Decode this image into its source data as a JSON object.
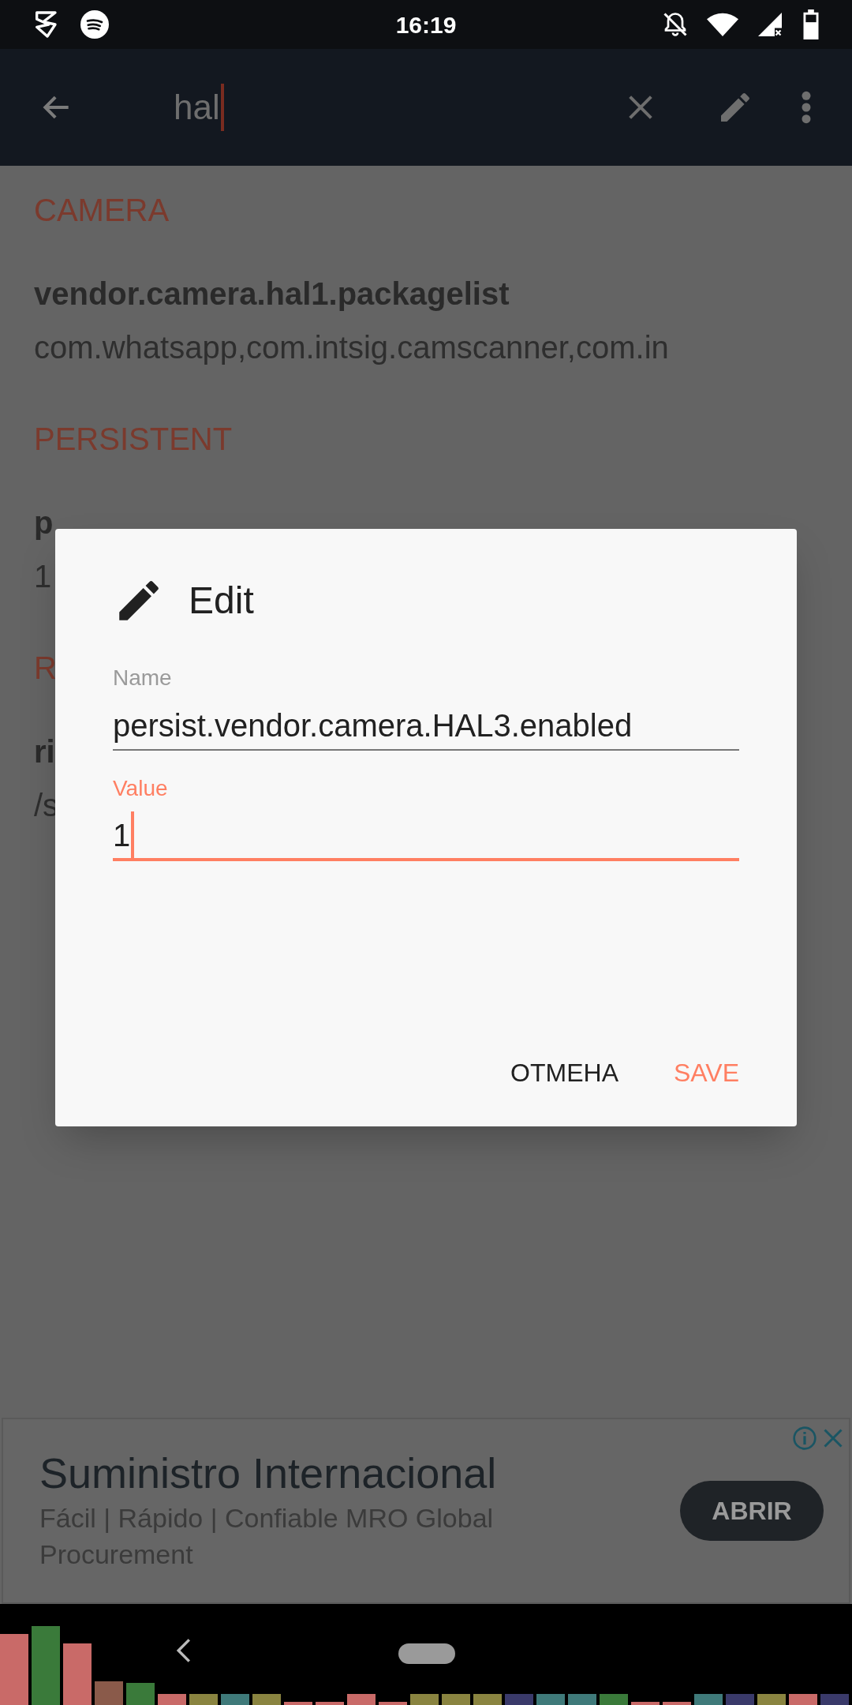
{
  "status_bar": {
    "time": "16:19"
  },
  "toolbar": {
    "search": {
      "value": "hal"
    }
  },
  "sections": [
    {
      "title": "CAMERA",
      "items": [
        {
          "name": "vendor.camera.hal1.packagelist",
          "value": "com.whatsapp,com.intsig.camscanner,com.in"
        }
      ]
    },
    {
      "title": "PERSISTENT",
      "items": [
        {
          "name": "p",
          "value": "1"
        }
      ]
    },
    {
      "title": "R",
      "items": [
        {
          "name": "ri",
          "value": "/s"
        }
      ]
    }
  ],
  "dialog": {
    "title": "Edit",
    "fields": [
      {
        "label": "Name",
        "value": "persist.vendor.camera.HAL3.enabled",
        "focused": false
      },
      {
        "label": "Value",
        "value": "1",
        "focused": true
      }
    ],
    "buttons": [
      {
        "label": "ОТМЕНА",
        "kind": "cancel"
      },
      {
        "label": "SAVE",
        "kind": "primary"
      }
    ]
  },
  "ad": {
    "title": "Suministro Internacional",
    "description": "Fácil | Rápido | Confiable MRO Global Procurement",
    "button": "ABRIR"
  }
}
